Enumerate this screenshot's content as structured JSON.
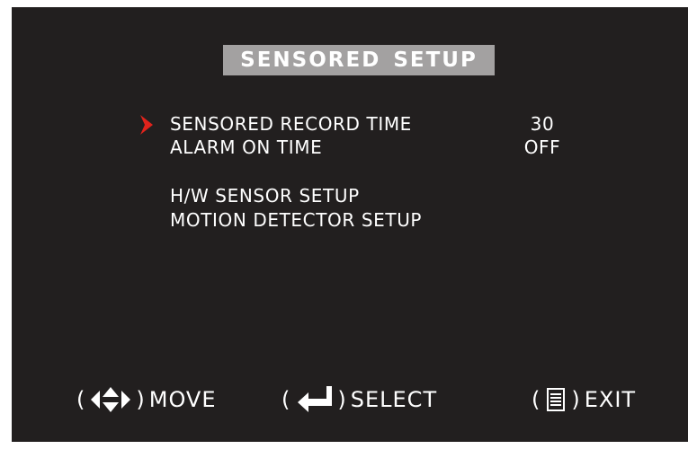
{
  "menu": {
    "title": "SENSORED SETUP",
    "items": [
      {
        "label": "SENSORED RECORD TIME",
        "value": "30",
        "selected": true
      },
      {
        "label": "ALARM ON TIME",
        "value": "OFF",
        "selected": false
      },
      {
        "label": "H/W SENSOR SETUP",
        "value": "",
        "selected": false
      },
      {
        "label": "MOTION DETECTOR SETUP",
        "value": "",
        "selected": false
      }
    ]
  },
  "footer": {
    "move": {
      "icon": "four-way-arrow-icon",
      "label": "MOVE"
    },
    "select": {
      "icon": "enter-arrow-icon",
      "label": "SELECT"
    },
    "exit": {
      "icon": "menu-list-icon",
      "label": "EXIT"
    }
  },
  "colors": {
    "background": "#221f1f",
    "title_bar": "#a3a1a1",
    "text": "#ffffff",
    "cursor": "#e0231c"
  }
}
